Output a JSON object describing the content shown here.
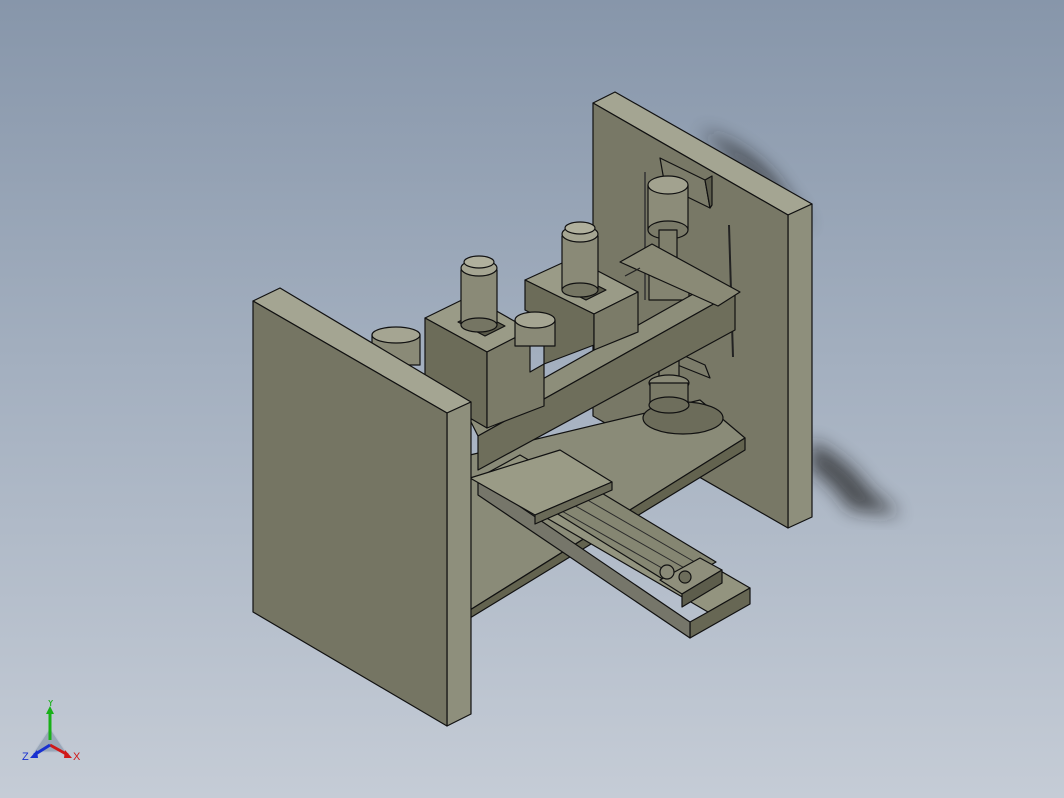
{
  "viewport": {
    "background_top": "#8796aa",
    "background_bottom": "#c5ccd6",
    "model_color": "#777766",
    "edge_color": "#111111"
  },
  "triad": {
    "x_label": "X",
    "y_label": "Y",
    "z_label": "Z",
    "x_color": "#d01818",
    "y_color": "#18b018",
    "z_color": "#1830d0"
  }
}
